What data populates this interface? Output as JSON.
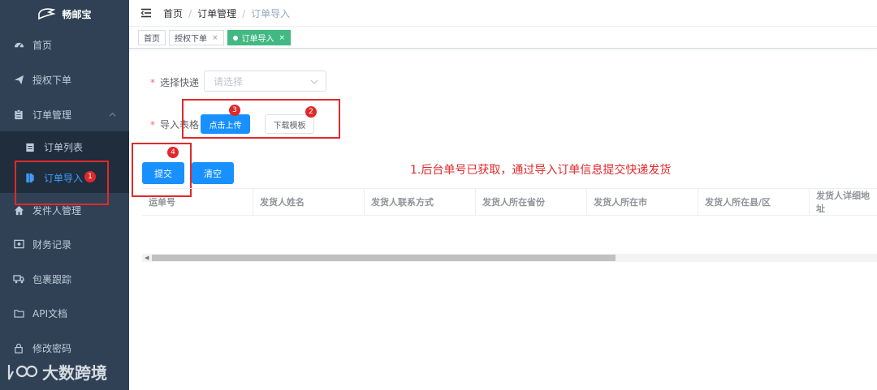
{
  "app": {
    "logo_text": "畅邮宝"
  },
  "sidebar": {
    "items": [
      {
        "label": "首页",
        "icon": "dashboard-icon"
      },
      {
        "label": "授权下单",
        "icon": "send-icon"
      },
      {
        "label": "订单管理",
        "icon": "clipboard-icon"
      },
      {
        "label": "订单列表",
        "icon": "list-icon"
      },
      {
        "label": "订单导入",
        "icon": "import-icon"
      },
      {
        "label": "发件人管理",
        "icon": "home-icon"
      },
      {
        "label": "财务记录",
        "icon": "wallet-icon"
      },
      {
        "label": "包裹跟踪",
        "icon": "truck-icon"
      },
      {
        "label": "API文档",
        "icon": "folder-icon"
      },
      {
        "label": "修改密码",
        "icon": "lock-icon"
      }
    ]
  },
  "breadcrumb": [
    "首页",
    "订单管理",
    "订单导入"
  ],
  "tags": [
    {
      "label": "首页"
    },
    {
      "label": "授权下单",
      "close": "×"
    },
    {
      "label": "订单导入",
      "close": "×"
    }
  ],
  "form": {
    "express_label": "选择快递",
    "express_placeholder": "请选择",
    "import_label": "导入表格",
    "upload_button": "点击上传",
    "download_button": "下载模板",
    "submit_button": "提交",
    "clear_button": "清空",
    "required_mark": "*"
  },
  "table": {
    "columns": [
      "运单号",
      "发货人姓名",
      "发货人联系方式",
      "发货人所在省份",
      "发货人所在市",
      "发货人所在县/区",
      "发货人详细地址"
    ],
    "rows": []
  },
  "annotations": {
    "note": "1.后台单号已获取，通过导入订单信息提交快递发货",
    "badges": [
      "1",
      "2",
      "3",
      "4"
    ]
  },
  "watermark": {
    "text": "大数跨境"
  },
  "colors": {
    "sidebar_bg": "#304156",
    "primary": "#1890ff",
    "active_tag": "#42b983",
    "annotation_red": "#e0292b"
  }
}
